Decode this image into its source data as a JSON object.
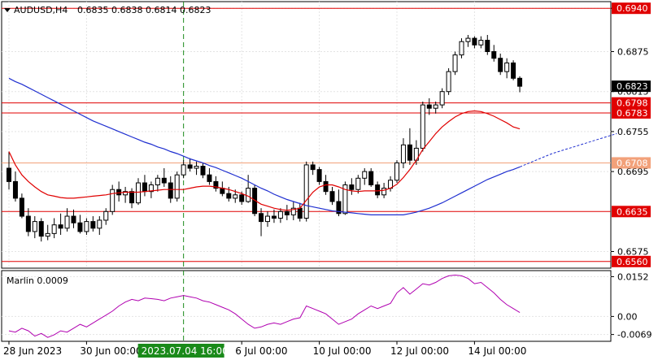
{
  "header": {
    "menu_arrow": "triangle-down-icon",
    "symbol": "AUDUSD,H4",
    "ohlc": "0.6835 0.6838 0.6814 0.6823"
  },
  "price_axis": {
    "ticks": [
      "0.6940",
      "0.6875",
      "0.6815",
      "0.6755",
      "0.6695",
      "0.6575"
    ],
    "tick_values": [
      0.694,
      0.6875,
      0.6815,
      0.6755,
      0.6695,
      0.6575
    ]
  },
  "level_labels": [
    {
      "value": 0.694,
      "text": "0.6940",
      "color": "#e00000"
    },
    {
      "value": 0.6798,
      "text": "0.6798",
      "color": "#e00000"
    },
    {
      "value": 0.6783,
      "text": "0.6783",
      "color": "#e00000"
    },
    {
      "value": 0.6708,
      "text": "0.6708",
      "color": "#f2a17a"
    },
    {
      "value": 0.6635,
      "text": "0.6635",
      "color": "#e00000"
    },
    {
      "value": 0.656,
      "text": "0.6560",
      "color": "#e00000"
    }
  ],
  "current_price": {
    "value": 0.6823,
    "text": "0.6823"
  },
  "indicator": {
    "name": "Marlin 0.0009",
    "ticks": [
      "0.0152",
      "0.00",
      "-0.0069"
    ],
    "tick_values": [
      0.0152,
      0.0,
      -0.0069
    ]
  },
  "time_axis": {
    "labels": [
      "28 Jun 2023",
      "30 Jun 00:00",
      "6 Jul 00:00",
      "10 Jul 00:00",
      "12 Jul 00:00",
      "14 Jul 00:00"
    ],
    "cursor_label": "2023.07.04 16:00"
  },
  "colors": {
    "bull": "#ffffff",
    "bear": "#000000",
    "level_red": "#e00000",
    "level_orange": "#f2a17a",
    "ma_fast": "#e00000",
    "ma_slow": "#1f2fd0",
    "oscillator": "#b000b0",
    "cursor": "#1a8a1a",
    "cursor_label_bg": "#1a8a1a",
    "current_label_bg": "#000000"
  },
  "chart_data": {
    "type": "candlestick",
    "price_range": [
      0.655,
      0.695
    ],
    "candles": [
      [
        0.67,
        0.6725,
        0.6668,
        0.668
      ],
      [
        0.668,
        0.6695,
        0.665,
        0.6655
      ],
      [
        0.6655,
        0.6662,
        0.6625,
        0.6628
      ],
      [
        0.6628,
        0.664,
        0.6598,
        0.6605
      ],
      [
        0.6605,
        0.6628,
        0.6595,
        0.662
      ],
      [
        0.662,
        0.6625,
        0.659,
        0.6598
      ],
      [
        0.6598,
        0.6615,
        0.6592,
        0.6602
      ],
      [
        0.6602,
        0.6625,
        0.6595,
        0.6615
      ],
      [
        0.6615,
        0.6632,
        0.66,
        0.661
      ],
      [
        0.661,
        0.664,
        0.6605,
        0.6628
      ],
      [
        0.6628,
        0.6638,
        0.661,
        0.6618
      ],
      [
        0.6618,
        0.663,
        0.6602,
        0.6605
      ],
      [
        0.6605,
        0.6625,
        0.66,
        0.662
      ],
      [
        0.662,
        0.6628,
        0.6605,
        0.661
      ],
      [
        0.661,
        0.6628,
        0.66,
        0.6622
      ],
      [
        0.6622,
        0.664,
        0.6615,
        0.6635
      ],
      [
        0.6635,
        0.6675,
        0.663,
        0.6668
      ],
      [
        0.6668,
        0.668,
        0.665,
        0.666
      ],
      [
        0.666,
        0.6672,
        0.6648,
        0.6665
      ],
      [
        0.6665,
        0.667,
        0.664,
        0.6648
      ],
      [
        0.6648,
        0.6685,
        0.6645,
        0.6678
      ],
      [
        0.6678,
        0.669,
        0.6658,
        0.6665
      ],
      [
        0.6665,
        0.668,
        0.6655,
        0.6675
      ],
      [
        0.6675,
        0.669,
        0.6665,
        0.6685
      ],
      [
        0.6685,
        0.67,
        0.6672,
        0.6678
      ],
      [
        0.6678,
        0.6688,
        0.6648,
        0.6655
      ],
      [
        0.6655,
        0.6695,
        0.665,
        0.669
      ],
      [
        0.669,
        0.6712,
        0.6685,
        0.6705
      ],
      [
        0.6705,
        0.6715,
        0.6695,
        0.67
      ],
      [
        0.67,
        0.671,
        0.669,
        0.6703
      ],
      [
        0.6703,
        0.6708,
        0.6685,
        0.669
      ],
      [
        0.669,
        0.67,
        0.6675,
        0.668
      ],
      [
        0.668,
        0.6688,
        0.6665,
        0.667
      ],
      [
        0.667,
        0.668,
        0.6658,
        0.6662
      ],
      [
        0.6662,
        0.6672,
        0.665,
        0.6655
      ],
      [
        0.6655,
        0.6668,
        0.6648,
        0.666
      ],
      [
        0.666,
        0.6665,
        0.6645,
        0.665
      ],
      [
        0.665,
        0.669,
        0.6648,
        0.667
      ],
      [
        0.667,
        0.6675,
        0.6628,
        0.6632
      ],
      [
        0.6632,
        0.664,
        0.6598,
        0.662
      ],
      [
        0.662,
        0.6635,
        0.6612,
        0.6628
      ],
      [
        0.6628,
        0.6638,
        0.6618,
        0.6625
      ],
      [
        0.6625,
        0.664,
        0.6618,
        0.6635
      ],
      [
        0.6635,
        0.6645,
        0.6622,
        0.663
      ],
      [
        0.663,
        0.665,
        0.6622,
        0.664
      ],
      [
        0.664,
        0.6648,
        0.662,
        0.6625
      ],
      [
        0.6625,
        0.671,
        0.662,
        0.6705
      ],
      [
        0.6705,
        0.671,
        0.669,
        0.6698
      ],
      [
        0.6698,
        0.6702,
        0.6675,
        0.668
      ],
      [
        0.668,
        0.669,
        0.666,
        0.6665
      ],
      [
        0.6665,
        0.6672,
        0.6645,
        0.665
      ],
      [
        0.665,
        0.6668,
        0.6628,
        0.6632
      ],
      [
        0.6632,
        0.668,
        0.663,
        0.6675
      ],
      [
        0.6675,
        0.6685,
        0.666,
        0.6668
      ],
      [
        0.6668,
        0.669,
        0.6662,
        0.6685
      ],
      [
        0.6685,
        0.67,
        0.6675,
        0.6695
      ],
      [
        0.6695,
        0.67,
        0.6672,
        0.6675
      ],
      [
        0.6675,
        0.668,
        0.6655,
        0.666
      ],
      [
        0.666,
        0.6678,
        0.6655,
        0.667
      ],
      [
        0.667,
        0.6688,
        0.6665,
        0.6682
      ],
      [
        0.6682,
        0.6712,
        0.6678,
        0.6708
      ],
      [
        0.6708,
        0.6745,
        0.67,
        0.6735
      ],
      [
        0.6735,
        0.676,
        0.6705,
        0.6712
      ],
      [
        0.6712,
        0.6742,
        0.6705,
        0.673
      ],
      [
        0.673,
        0.68,
        0.6725,
        0.6795
      ],
      [
        0.6795,
        0.6805,
        0.678,
        0.679
      ],
      [
        0.679,
        0.68,
        0.6782,
        0.6795
      ],
      [
        0.6795,
        0.682,
        0.679,
        0.6815
      ],
      [
        0.6815,
        0.685,
        0.681,
        0.6845
      ],
      [
        0.6845,
        0.6875,
        0.684,
        0.687
      ],
      [
        0.687,
        0.6895,
        0.6865,
        0.689
      ],
      [
        0.689,
        0.69,
        0.6882,
        0.6895
      ],
      [
        0.6895,
        0.6898,
        0.688,
        0.6885
      ],
      [
        0.6885,
        0.6898,
        0.688,
        0.6892
      ],
      [
        0.6892,
        0.69,
        0.687,
        0.6875
      ],
      [
        0.6875,
        0.6885,
        0.686,
        0.6865
      ],
      [
        0.6865,
        0.6872,
        0.684,
        0.6845
      ],
      [
        0.6845,
        0.6865,
        0.6835,
        0.6858
      ],
      [
        0.6858,
        0.6862,
        0.6832,
        0.6835
      ],
      [
        0.6835,
        0.6838,
        0.6814,
        0.6823
      ]
    ],
    "ma_fast": [
      0.6725,
      0.6705,
      0.669,
      0.668,
      0.6672,
      0.6665,
      0.666,
      0.6658,
      0.6656,
      0.6655,
      0.6655,
      0.6656,
      0.6657,
      0.6658,
      0.6659,
      0.666,
      0.6662,
      0.6663,
      0.6664,
      0.6664,
      0.6664,
      0.6665,
      0.6666,
      0.6667,
      0.6668,
      0.6668,
      0.6668,
      0.6668,
      0.667,
      0.6672,
      0.6673,
      0.6673,
      0.6672,
      0.667,
      0.6668,
      0.6665,
      0.6662,
      0.6658,
      0.6652,
      0.6646,
      0.6643,
      0.664,
      0.6638,
      0.6637,
      0.6638,
      0.664,
      0.6652,
      0.6664,
      0.6672,
      0.6675,
      0.6675,
      0.6672,
      0.6668,
      0.6666,
      0.6665,
      0.6666,
      0.6666,
      0.6666,
      0.6667,
      0.667,
      0.6676,
      0.6686,
      0.6698,
      0.6712,
      0.6728,
      0.674,
      0.6752,
      0.6762,
      0.677,
      0.6777,
      0.6782,
      0.6785,
      0.6786,
      0.6785,
      0.6782,
      0.6778,
      0.6773,
      0.6768,
      0.6762,
      0.6759
    ],
    "ma_slow": [
      0.6835,
      0.683,
      0.6826,
      0.6821,
      0.6816,
      0.6811,
      0.6806,
      0.6801,
      0.6796,
      0.6791,
      0.6786,
      0.6781,
      0.6776,
      0.6771,
      0.6767,
      0.6763,
      0.6759,
      0.6755,
      0.6751,
      0.6747,
      0.6743,
      0.6739,
      0.6736,
      0.6732,
      0.6729,
      0.6725,
      0.6722,
      0.6718,
      0.6714,
      0.6711,
      0.6708,
      0.6704,
      0.6701,
      0.6697,
      0.6693,
      0.6689,
      0.6685,
      0.668,
      0.6675,
      0.667,
      0.6666,
      0.6661,
      0.6657,
      0.6653,
      0.665,
      0.6647,
      0.6644,
      0.6642,
      0.664,
      0.6638,
      0.6636,
      0.6635,
      0.6634,
      0.6633,
      0.6632,
      0.6631,
      0.663,
      0.663,
      0.663,
      0.663,
      0.663,
      0.663,
      0.6632,
      0.6634,
      0.6637,
      0.664,
      0.6644,
      0.6648,
      0.6653,
      0.6658,
      0.6663,
      0.6668,
      0.6673,
      0.6678,
      0.6683,
      0.6687,
      0.6691,
      0.6695,
      0.6698,
      0.6702
    ],
    "ma_slow_projection": [
      0.6702,
      0.6706,
      0.671,
      0.6714,
      0.6718,
      0.6722,
      0.6725,
      0.6728,
      0.6731,
      0.6734,
      0.6737,
      0.674,
      0.6743,
      0.6746,
      0.6749,
      0.6752
    ],
    "oscillator_range": [
      -0.0095,
      0.0175
    ],
    "oscillator": [
      -0.0055,
      -0.006,
      -0.0045,
      -0.0055,
      -0.0075,
      -0.0065,
      -0.008,
      -0.007,
      -0.0055,
      -0.006,
      -0.0045,
      -0.003,
      -0.004,
      -0.0025,
      -0.001,
      0.0005,
      0.002,
      0.004,
      0.0055,
      0.0065,
      0.006,
      0.007,
      0.0068,
      0.0065,
      0.006,
      0.007,
      0.0075,
      0.008,
      0.0075,
      0.007,
      0.006,
      0.0055,
      0.0045,
      0.0035,
      0.0025,
      0.001,
      -0.001,
      -0.003,
      -0.0045,
      -0.004,
      -0.003,
      -0.0025,
      -0.003,
      -0.002,
      -0.001,
      -0.0005,
      0.004,
      0.003,
      0.002,
      0.001,
      -0.001,
      -0.003,
      -0.002,
      -0.001,
      0.001,
      0.0025,
      0.004,
      0.003,
      0.004,
      0.005,
      0.009,
      0.011,
      0.0085,
      0.0105,
      0.0125,
      0.012,
      0.013,
      0.0145,
      0.0155,
      0.0158,
      0.0155,
      0.0145,
      0.0125,
      0.013,
      0.011,
      0.009,
      0.0065,
      0.0045,
      0.003,
      0.0015
    ],
    "cursor_index": 27,
    "time_label_indices": [
      0,
      12,
      36,
      48,
      60,
      72
    ]
  }
}
